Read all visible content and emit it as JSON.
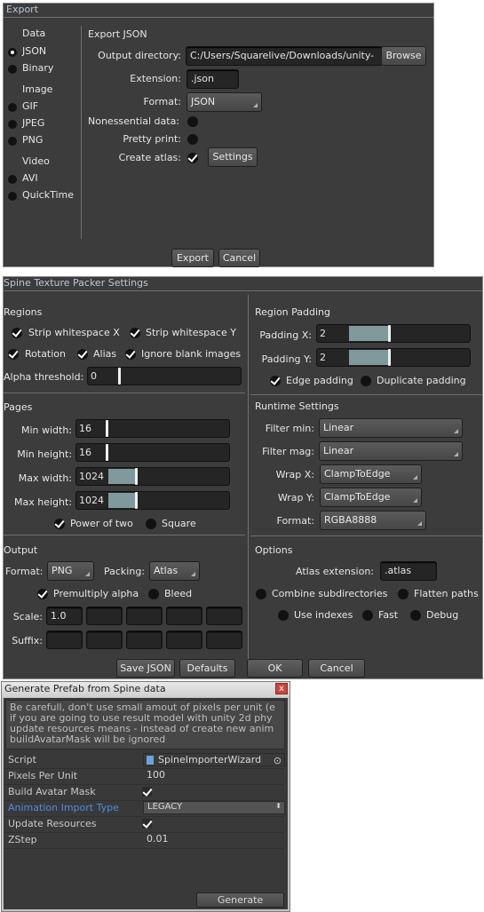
{
  "export_dialog": {
    "title": "Export",
    "left": {
      "data_header": "Data",
      "data_items": [
        "JSON",
        "Binary"
      ],
      "image_header": "Image",
      "image_items": [
        "GIF",
        "JPEG",
        "PNG"
      ],
      "video_header": "Video",
      "video_items": [
        "AVI",
        "QuickTime"
      ],
      "selected": "JSON"
    },
    "section_title": "Export JSON",
    "output_directory_label": "Output directory:",
    "output_directory_value": "C:/Users/Squarelive/Downloads/unity-",
    "browse_label": "Browse",
    "extension_label": "Extension:",
    "extension_value": ".json",
    "format_label": "Format:",
    "format_value": "JSON",
    "nonessential_label": "Nonessential data:",
    "pretty_print_label": "Pretty print:",
    "create_atlas_label": "Create atlas:",
    "settings_label": "Settings",
    "export_label": "Export",
    "cancel_label": "Cancel"
  },
  "packer": {
    "title": "Spine Texture Packer Settings",
    "regions": {
      "header": "Regions",
      "strip_x": "Strip whitespace X",
      "strip_y": "Strip whitespace Y",
      "rotation": "Rotation",
      "alias": "Alias",
      "ignore_blank": "Ignore blank images",
      "alpha_threshold_label": "Alpha threshold:",
      "alpha_threshold_value": "0"
    },
    "region_padding": {
      "header": "Region Padding",
      "padding_x_label": "Padding X:",
      "padding_x_value": "2",
      "padding_y_label": "Padding Y:",
      "padding_y_value": "2",
      "edge_padding": "Edge padding",
      "duplicate_padding": "Duplicate padding"
    },
    "pages": {
      "header": "Pages",
      "min_width_label": "Min width:",
      "min_width_value": "16",
      "min_height_label": "Min height:",
      "min_height_value": "16",
      "max_width_label": "Max width:",
      "max_width_value": "1024",
      "max_height_label": "Max height:",
      "max_height_value": "1024",
      "power_of_two": "Power of two",
      "square": "Square"
    },
    "runtime": {
      "header": "Runtime Settings",
      "filter_min_label": "Filter min:",
      "filter_min_value": "Linear",
      "filter_mag_label": "Filter mag:",
      "filter_mag_value": "Linear",
      "wrap_x_label": "Wrap X:",
      "wrap_x_value": "ClampToEdge",
      "wrap_y_label": "Wrap Y:",
      "wrap_y_value": "ClampToEdge",
      "format_label": "Format:",
      "format_value": "RGBA8888"
    },
    "output": {
      "header": "Output",
      "format_label": "Format:",
      "format_value": "PNG",
      "packing_label": "Packing:",
      "packing_value": "Atlas",
      "premultiply": "Premultiply alpha",
      "bleed": "Bleed",
      "scale_label": "Scale:",
      "scale_value": "1.0",
      "suffix_label": "Suffix:"
    },
    "options": {
      "header": "Options",
      "atlas_ext_label": "Atlas extension:",
      "atlas_ext_value": ".atlas",
      "combine_subdirs": "Combine subdirectories",
      "flatten_paths": "Flatten paths",
      "use_indexes": "Use indexes",
      "fast": "Fast",
      "debug": "Debug"
    },
    "buttons": {
      "save_json": "Save JSON",
      "defaults": "Defaults",
      "ok": "OK",
      "cancel": "Cancel"
    }
  },
  "prefab": {
    "title": "Generate Prefab from Spine data",
    "close_glyph": "x",
    "help_lines": [
      "Be carefull, don't use small amout of pixels per unit (e",
      "if you are going to use result model with unity 2d phy",
      "update resources means - instead of create new anim",
      " buildAvatarMask will be ignored"
    ],
    "script_label": "Script",
    "script_value": "SpineImporterWizard",
    "ppu_label": "Pixels Per Unit",
    "ppu_value": "100",
    "avatar_mask_label": "Build Avatar Mask",
    "anim_type_label": "Animation Import Type",
    "anim_type_value": "LEGACY",
    "update_resources_label": "Update Resources",
    "zstep_label": "ZStep",
    "zstep_value": "0.01",
    "generate_label": "Generate"
  }
}
